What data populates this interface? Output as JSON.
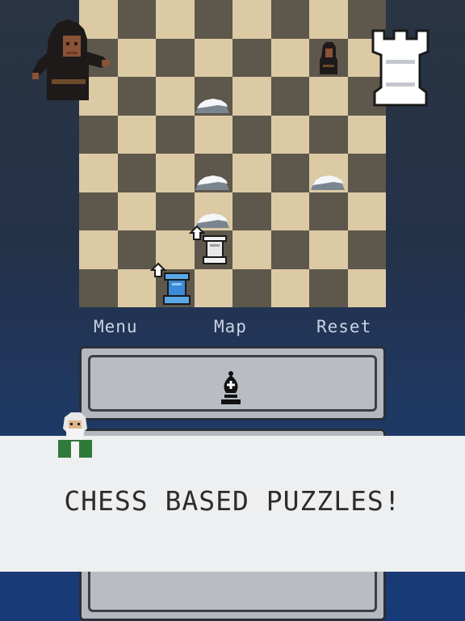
{
  "nav": {
    "menu_label": "Menu",
    "map_label": "Map",
    "reset_label": "Reset"
  },
  "board": {
    "light_color": "#dccaa5",
    "dark_color": "#5e574b",
    "size": "8x8"
  },
  "hand_piece": {
    "icon": "black-bishop-icon"
  },
  "banner": {
    "text": "CHESS BASED PUZZLES!"
  }
}
